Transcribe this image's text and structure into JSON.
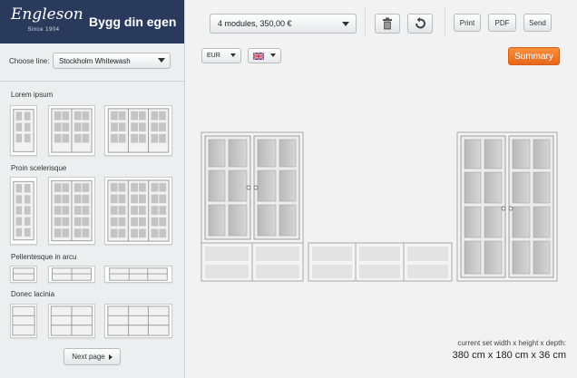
{
  "brand": {
    "logo_text": "Engleson",
    "logo_since": "Since 1904",
    "title": "Bygg din egen"
  },
  "sidebar": {
    "choose_line_label": "Choose line:",
    "selected_line": "Stockholm Whitewash",
    "categories": [
      {
        "label": "Lorem ipsum"
      },
      {
        "label": "Proin scelerisque"
      },
      {
        "label": "Pellentesque in arcu"
      },
      {
        "label": "Donec lacinia"
      }
    ],
    "next_page_label": "Next page"
  },
  "toolbar": {
    "config_value": "4 modules, 350,00 €",
    "delete_icon": "trash-icon",
    "undo_icon": "undo-icon",
    "print_label": "Print",
    "pdf_label": "PDF",
    "send_label": "Send"
  },
  "options": {
    "currency": "EUR",
    "language_flag": "uk-flag-icon",
    "summary_label": "Summary"
  },
  "dimensions": {
    "caption": "current set width x height x depth:",
    "value": "380 cm x 180 cm x 36 cm"
  },
  "colors": {
    "brand_navy": "#2a3a5c",
    "accent_orange": "#f07a28"
  }
}
